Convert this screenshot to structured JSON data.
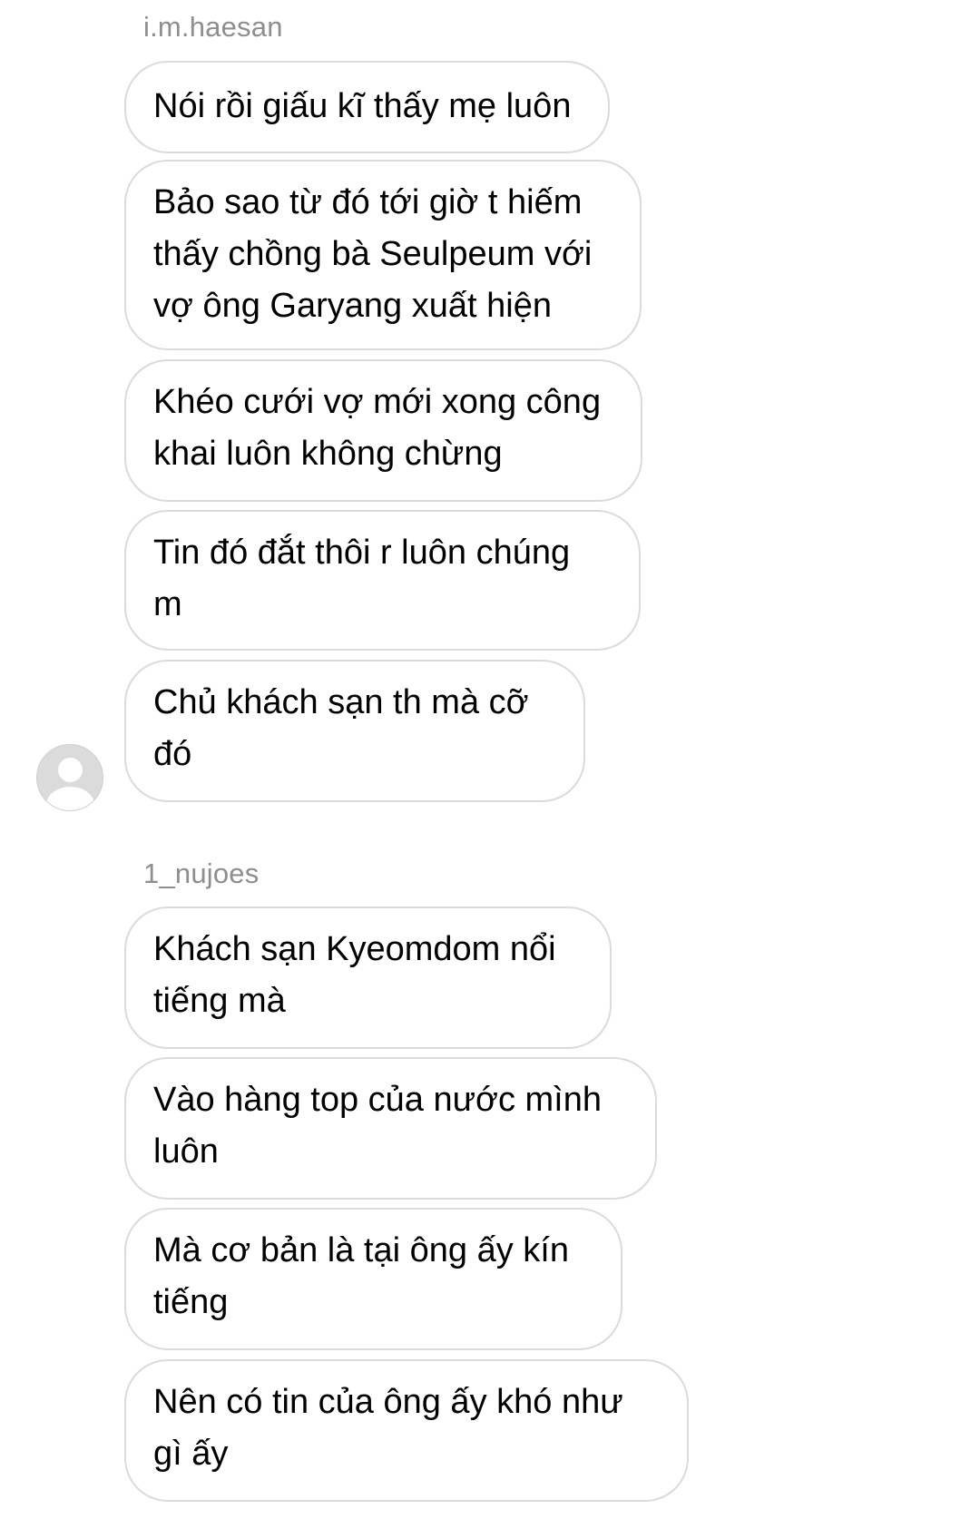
{
  "groups": [
    {
      "sender": "i.m.haesan",
      "messages": [
        {
          "lines": [
            "Nói rồi giấu kĩ thấy mẹ luôn"
          ]
        },
        {
          "lines": [
            "Bảo sao từ đó tới giờ t hiếm",
            "thấy chồng bà Seulpeum với",
            "vợ ông Garyang xuất hiện"
          ]
        },
        {
          "lines": [
            "Khéo cưới vợ mới xong công",
            "khai luôn không chừng"
          ]
        },
        {
          "lines": [
            "Tin đó đắt thôi r luôn chúng",
            "m"
          ]
        },
        {
          "lines": [
            "Chủ khách sạn th mà cỡ",
            "đó"
          ]
        }
      ]
    },
    {
      "sender": "1_nujoes",
      "messages": [
        {
          "lines": [
            "Khách sạn Kyeomdom nổi",
            "tiếng mà"
          ]
        },
        {
          "lines": [
            "Vào hàng top của nước mình",
            "luôn"
          ]
        },
        {
          "lines": [
            "Mà cơ bản là tại ông ấy kín",
            "tiếng"
          ]
        },
        {
          "lines": [
            "Nên có tin của ông ấy khó như",
            "gì ấy"
          ]
        }
      ]
    }
  ],
  "colors": {
    "sender_text": "#8e8e8e",
    "bubble_border": "#dbdbdb",
    "message_text": "#000000",
    "avatar_bg": "#dbdbdb"
  },
  "icons": {
    "avatar": "default-profile-avatar-icon"
  }
}
